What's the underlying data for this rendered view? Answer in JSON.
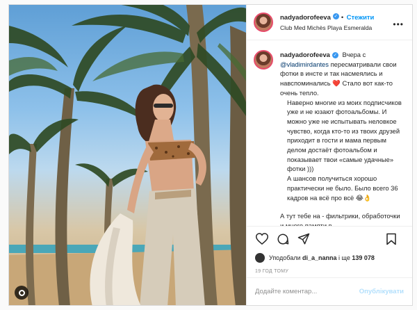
{
  "post": {
    "username": "nadyadorofeeva",
    "follow_label": "Стежити",
    "separator": "•",
    "location": "Club Med Michès Playa Esmeralda",
    "more_glyph": "•••"
  },
  "caption": {
    "username": "nadyadorofeeva",
    "p1_a": "Вчера с",
    "mention": "@vladimirdantes",
    "p1_b": "пересматривали свои фотки в инсте и так насмеялись и навспоминались",
    "heart": "❤️",
    "p1_c": "Стало вот как-то очень тепло.",
    "p2": "Наверно многие из моих подписчиков уже и не юзают фотоальбомы. И можно уже не испытывать неловкое чувство, когда кто-то из твоих друзей приходит в гости и мама первым делом достаёт фотоальбом и показывает твои «самые удачные» фотки )))",
    "p3": "А шансов получиться хорошо практически не было. Было всего 36 кадров на всё про всё",
    "p3_emoji": "😂👌",
    "p4": "А тут тебе на - фильтрики, обработочки и много памяти в"
  },
  "likes": {
    "prefix": "Уподобали",
    "user": "di_a_nanna",
    "middle": "і ще",
    "count": "139 078"
  },
  "timestamp": "19 ГОД ТОМУ",
  "comment": {
    "placeholder": "Додайте коментар...",
    "publish_label": "Опублікувати"
  },
  "colors": {
    "accent": "#0095f6",
    "publish_disabled": "#b2dffc",
    "heart": "#ed4956",
    "verified": "#3897f0"
  },
  "icons": [
    "heart-icon",
    "comment-icon",
    "share-icon",
    "bookmark-icon",
    "tag-icon"
  ]
}
